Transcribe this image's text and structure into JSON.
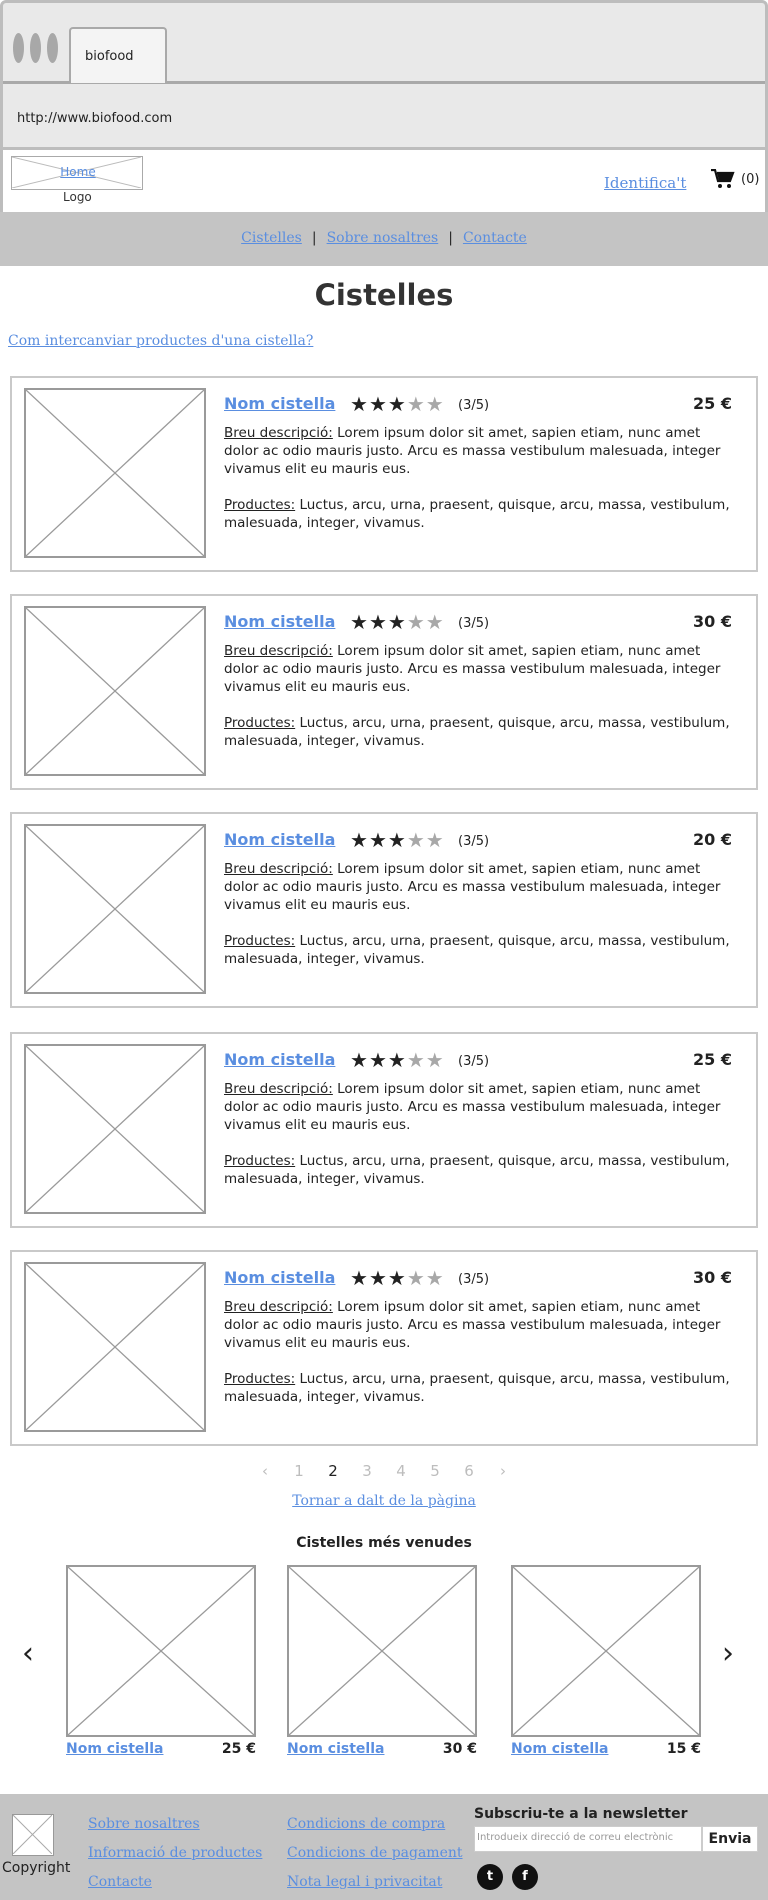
{
  "browser": {
    "tab_title": "biofood",
    "url": "http://www.biofood.com"
  },
  "header": {
    "logo_link": "Home",
    "logo_label": "Logo",
    "login": "Identifica't",
    "cart_count": "(0)"
  },
  "nav": {
    "items": [
      "Cistelles",
      "Sobre nosaltres",
      "Contacte"
    ],
    "separator": "|"
  },
  "page": {
    "title": "Cistelles",
    "swap_link": "Com intercanviar productes d'una cistella?"
  },
  "labels": {
    "description": "Breu descripció:",
    "products": "Productes:"
  },
  "baskets": [
    {
      "name": "Nom cistella",
      "rating": 3,
      "rating_max": 5,
      "rating_text": "(3/5)",
      "price": "25 €",
      "description": " Lorem ipsum dolor sit amet, sapien etiam, nunc amet dolor ac odio mauris justo. Arcu es massa vestibulum malesuada, integer vivamus elit eu mauris eus.",
      "products": " Luctus, arcu, urna, praesent, quisque, arcu, massa, vestibulum, malesuada, integer, vivamus."
    },
    {
      "name": "Nom cistella",
      "rating": 3,
      "rating_max": 5,
      "rating_text": "(3/5)",
      "price": "30 €",
      "description": " Lorem ipsum dolor sit amet, sapien etiam, nunc amet dolor ac odio mauris justo. Arcu es massa vestibulum malesuada, integer vivamus elit eu mauris eus.",
      "products": " Luctus, arcu, urna, praesent, quisque, arcu, massa, vestibulum, malesuada, integer, vivamus."
    },
    {
      "name": "Nom cistella",
      "rating": 3,
      "rating_max": 5,
      "rating_text": "(3/5)",
      "price": "20 €",
      "description": " Lorem ipsum dolor sit amet, sapien etiam, nunc amet dolor ac odio mauris justo. Arcu es massa vestibulum malesuada, integer vivamus elit eu mauris eus.",
      "products": " Luctus, arcu, urna, praesent, quisque, arcu, massa, vestibulum, malesuada, integer, vivamus."
    },
    {
      "name": "Nom cistella",
      "rating": 3,
      "rating_max": 5,
      "rating_text": "(3/5)",
      "price": "25 €",
      "description": " Lorem ipsum dolor sit amet, sapien etiam, nunc amet dolor ac odio mauris justo. Arcu es massa vestibulum malesuada, integer vivamus elit eu mauris eus.",
      "products": " Luctus, arcu, urna, praesent, quisque, arcu, massa, vestibulum, malesuada, integer, vivamus."
    },
    {
      "name": "Nom cistella",
      "rating": 3,
      "rating_max": 5,
      "rating_text": "(3/5)",
      "price": "30 €",
      "description": " Lorem ipsum dolor sit amet, sapien etiam, nunc amet dolor ac odio mauris justo. Arcu es massa vestibulum malesuada, integer vivamus elit eu mauris eus.",
      "products": " Luctus, arcu, urna, praesent, quisque, arcu, massa, vestibulum, malesuada, integer, vivamus."
    }
  ],
  "pagination": {
    "prev": "‹",
    "pages": [
      "1",
      "2",
      "3",
      "4",
      "5",
      "6"
    ],
    "current": "2",
    "next": "›"
  },
  "back_to_top": "Tornar a dalt de la pàgina",
  "best_sellers": {
    "title": "Cistelles més venudes",
    "prev": "‹",
    "next": "›",
    "items": [
      {
        "name": "Nom cistella",
        "price": "25 €"
      },
      {
        "name": "Nom cistella",
        "price": "30 €"
      },
      {
        "name": "Nom cistella",
        "price": "15 €"
      }
    ]
  },
  "footer": {
    "copyright": "Copyright",
    "col1": [
      "Sobre nosaltres",
      "Informació de productes",
      "Contacte"
    ],
    "col2": [
      "Condicions de compra",
      "Condicions de pagament",
      "Nota legal i privacitat"
    ],
    "newsletter_title": "Subscriu-te a la newsletter",
    "newsletter_placeholder": "Introdueix direcció de correu electrònic",
    "newsletter_button": "Envia"
  },
  "icons": {
    "cart": "cart-icon",
    "twitter": "twitter-icon",
    "facebook": "facebook-icon"
  }
}
